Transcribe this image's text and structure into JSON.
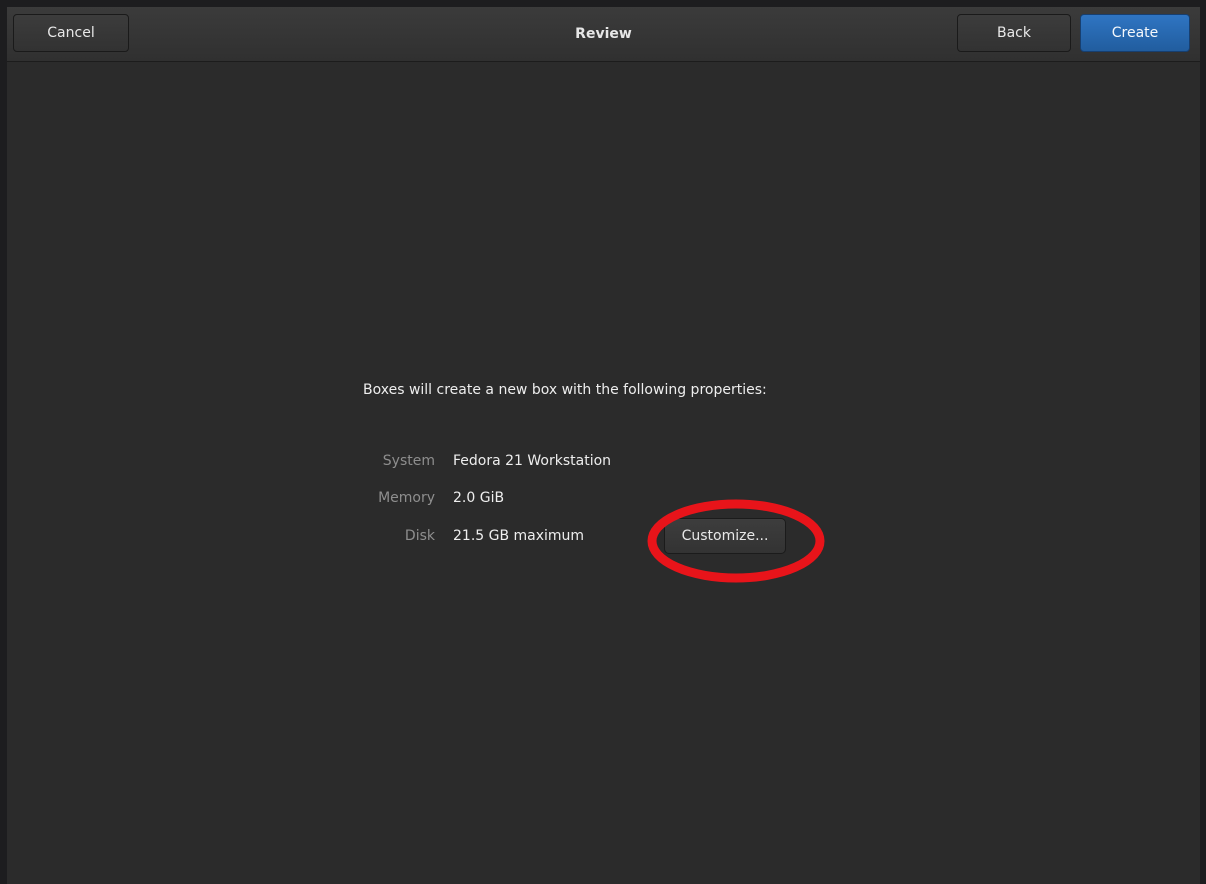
{
  "header": {
    "title": "Review",
    "cancel_label": "Cancel",
    "back_label": "Back",
    "create_label": "Create"
  },
  "review": {
    "intro": "Boxes will create a new box with the following properties:",
    "properties": [
      {
        "label": "System",
        "value": "Fedora 21 Workstation"
      },
      {
        "label": "Memory",
        "value": "2.0 GiB"
      },
      {
        "label": "Disk",
        "value": "21.5 GB maximum"
      }
    ],
    "customize_label": "Customize..."
  },
  "colors": {
    "accent": "#2a6ab3",
    "background": "#2b2b2b",
    "annotation": "#e8141a"
  }
}
